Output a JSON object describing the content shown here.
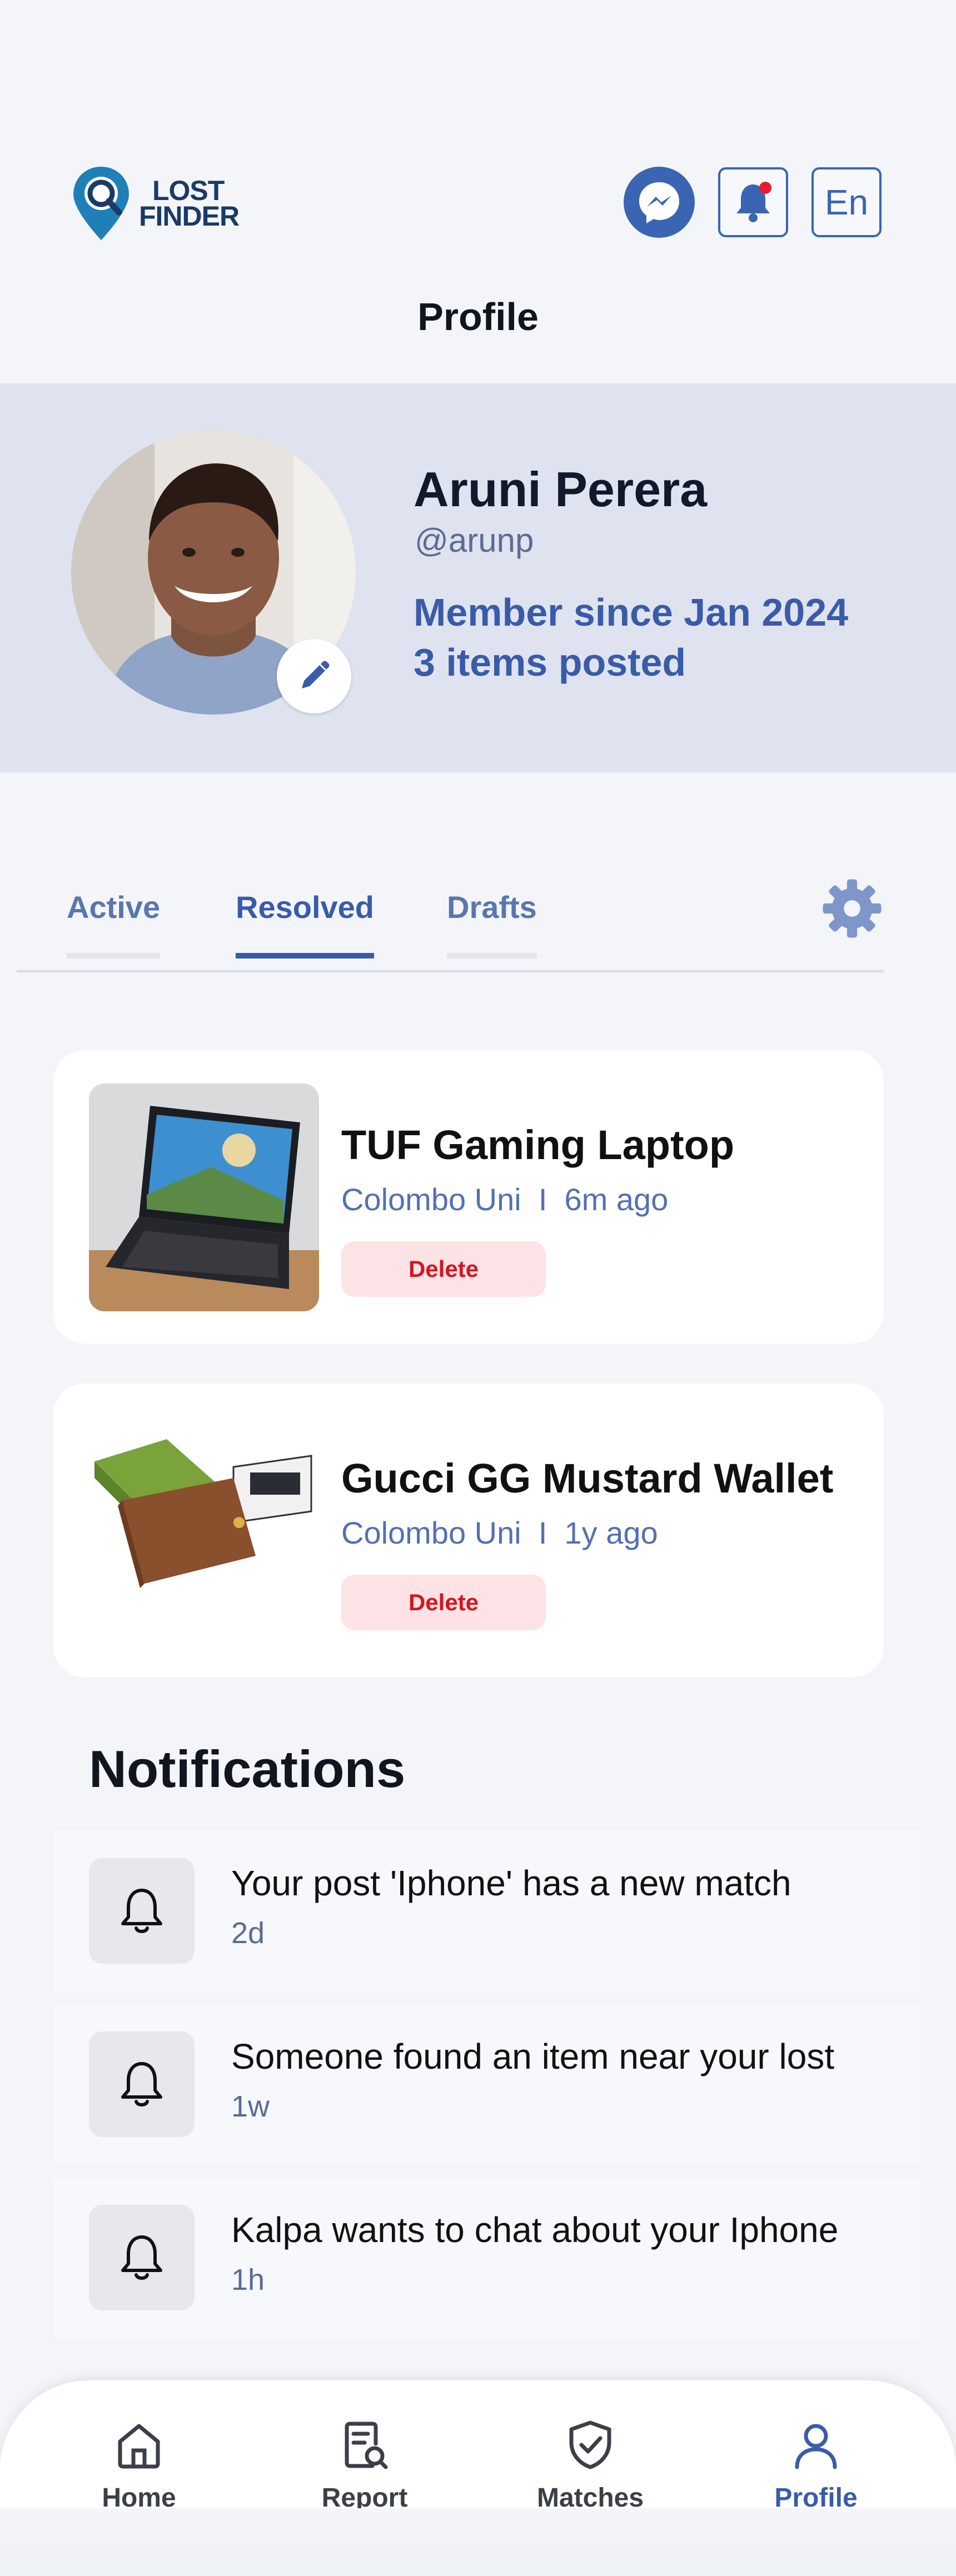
{
  "app": {
    "logo_line1": "LOST",
    "logo_line2": "FINDER",
    "language": "En",
    "accent": "#3a5ba8",
    "header_icons": [
      "messenger-icon",
      "bell-icon"
    ]
  },
  "page": {
    "title": "Profile"
  },
  "profile": {
    "name": "Aruni Perera",
    "handle": "@arunp",
    "member_since": "Member since Jan 2024",
    "items_posted": "3 items posted"
  },
  "tabs": [
    {
      "label": "Active",
      "selected": false
    },
    {
      "label": "Resolved",
      "selected": true
    },
    {
      "label": "Drafts",
      "selected": false
    }
  ],
  "posts": [
    {
      "title": "TUF Gaming Laptop",
      "location": "Colombo Uni",
      "separator": "I",
      "time": "6m ago",
      "delete_label": "Delete",
      "image": "laptop"
    },
    {
      "title": "Gucci GG Mustard  Wallet",
      "location": "Colombo Uni",
      "separator": "I",
      "time": "1y ago",
      "delete_label": "Delete",
      "image": "wallet"
    }
  ],
  "notifications": {
    "heading": "Notifications",
    "items": [
      {
        "text": "Your post 'Iphone' has a new match",
        "time": "2d"
      },
      {
        "text": "Someone found an item near your lost",
        "time": "1w"
      },
      {
        "text": "Kalpa wants to chat about your Iphone",
        "time": "1h"
      }
    ]
  },
  "nav": [
    {
      "label": "Home",
      "icon": "home-icon",
      "active": false
    },
    {
      "label": "Report",
      "icon": "report-icon",
      "active": false
    },
    {
      "label": "Matches",
      "icon": "shield-check-icon",
      "active": false
    },
    {
      "label": "Profile",
      "icon": "user-icon",
      "active": true
    }
  ]
}
